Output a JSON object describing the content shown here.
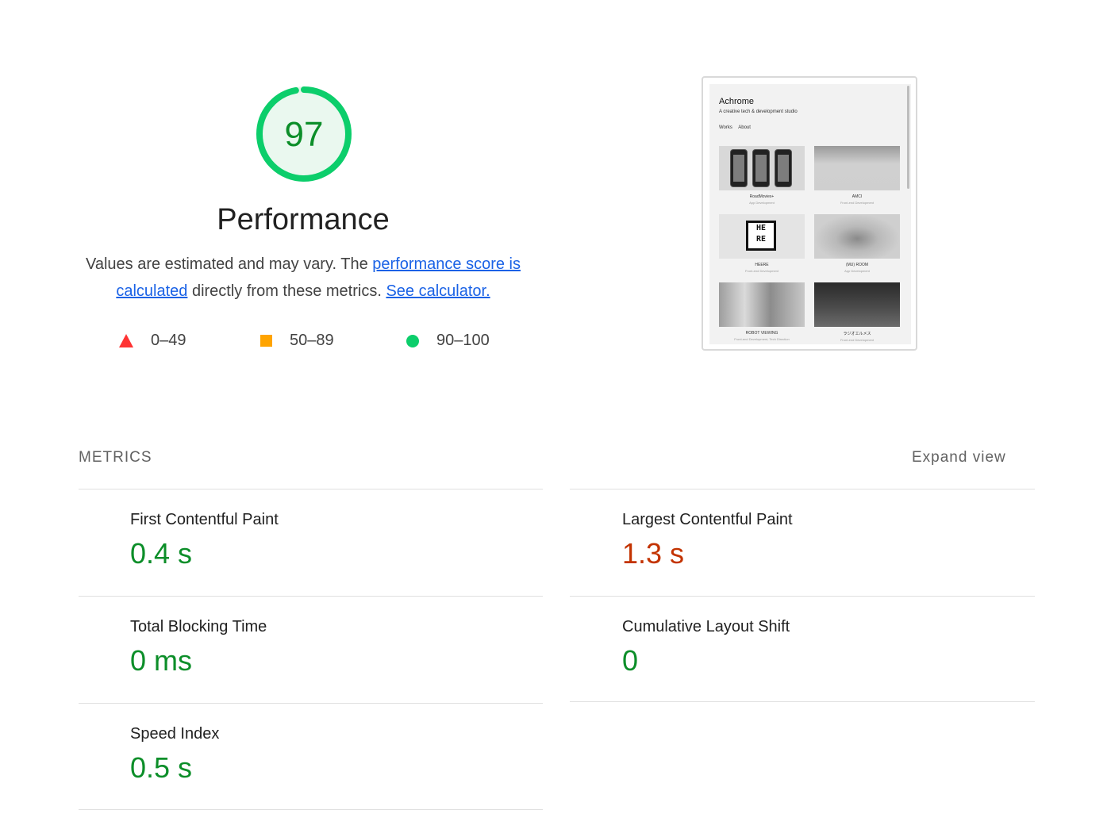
{
  "score": {
    "value": "97",
    "fraction": 0.97,
    "ring_color": "#0cce6b",
    "text_color": "#0c8e29",
    "title": "Performance"
  },
  "description": {
    "text1": "Values are estimated and may vary. The ",
    "link1": "performance score is calculated",
    "text2": " directly from these metrics. ",
    "link2": "See calculator."
  },
  "legend": [
    {
      "range": "0–49",
      "icon": "triangle-icon",
      "color": "#ff3333"
    },
    {
      "range": "50–89",
      "icon": "square-icon",
      "color": "#ffa400"
    },
    {
      "range": "90–100",
      "icon": "circle-icon",
      "color": "#0cce6b"
    }
  ],
  "screenshot": {
    "brand": "Achrome",
    "tagline": "A creative tech & development studio",
    "nav": [
      "Works",
      "About"
    ],
    "cards": [
      {
        "title": "RoadMovies+",
        "sub": "App Development"
      },
      {
        "title": "AMCI",
        "sub": "Front-end Development"
      },
      {
        "title": "HEERE",
        "sub": "Front-end Development"
      },
      {
        "title": "(MU) ROOM",
        "sub": "App Development"
      },
      {
        "title": "ROBOT VIEWING",
        "sub": "Front-end Development, Tech Direction"
      },
      {
        "title": "ラジオエルメス",
        "sub": "Front-end Development"
      }
    ]
  },
  "metrics": {
    "label": "METRICS",
    "expand": "Expand view",
    "items": [
      {
        "name": "First Contentful Paint",
        "value": "0.4 s",
        "status": "good"
      },
      {
        "name": "Largest Contentful Paint",
        "value": "1.3 s",
        "status": "poor"
      },
      {
        "name": "Total Blocking Time",
        "value": "0 ms",
        "status": "good"
      },
      {
        "name": "Cumulative Layout Shift",
        "value": "0",
        "status": "good"
      },
      {
        "name": "Speed Index",
        "value": "0.5 s",
        "status": "good"
      }
    ]
  }
}
